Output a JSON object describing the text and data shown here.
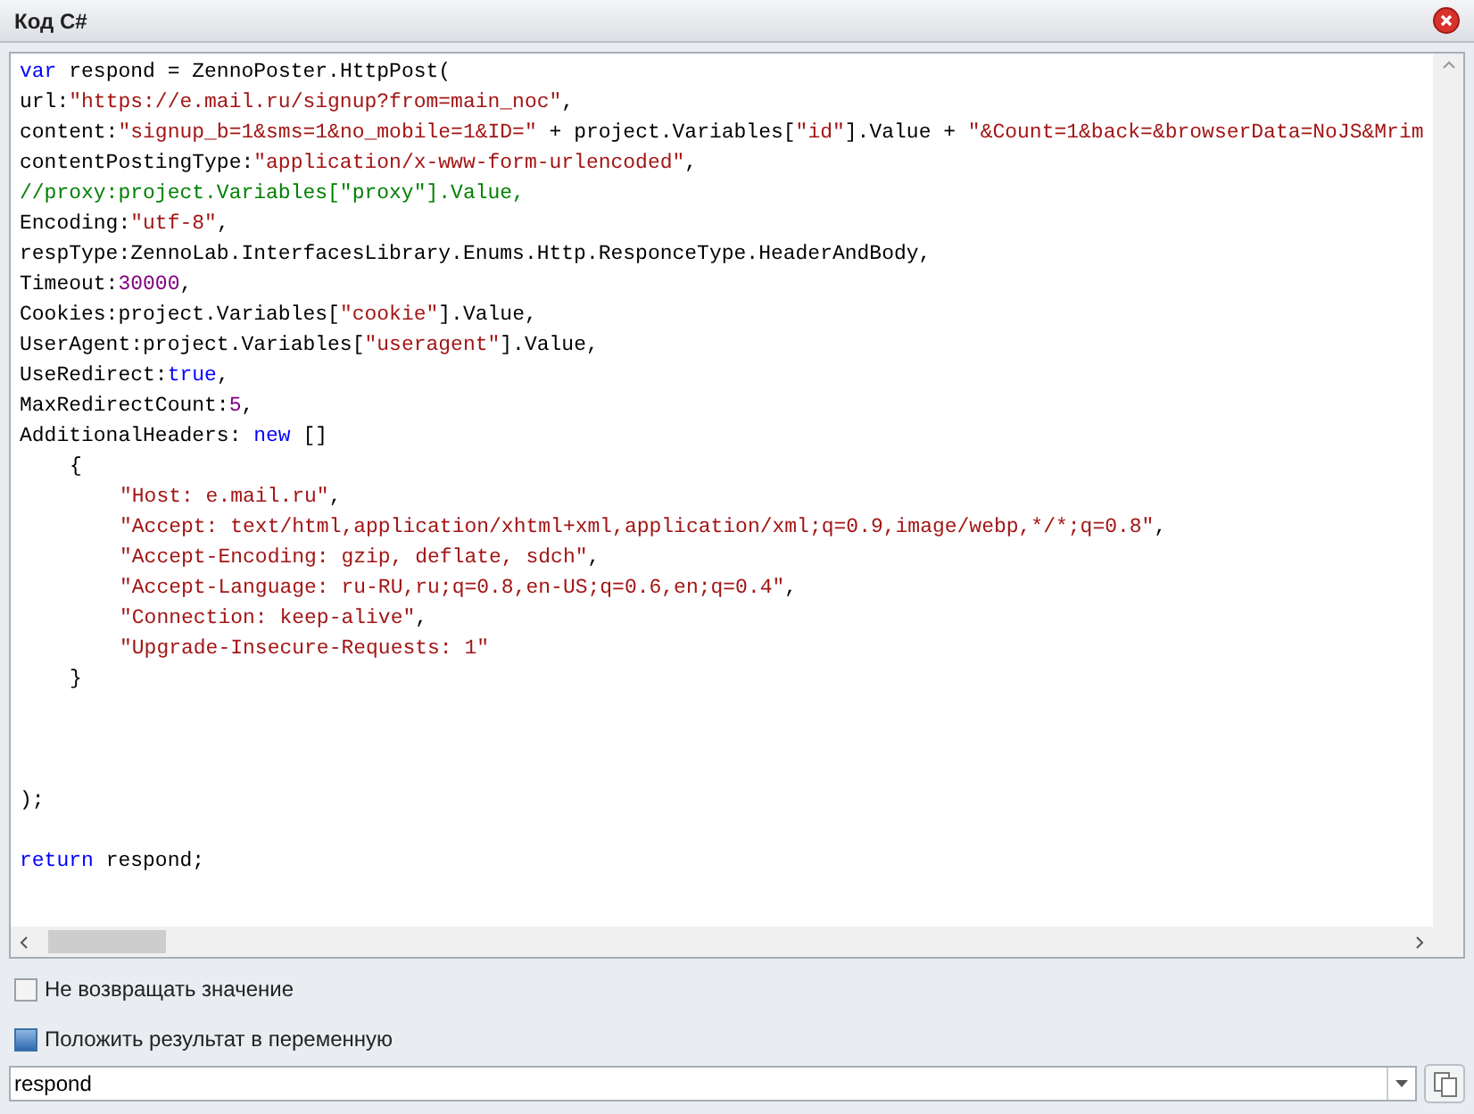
{
  "window": {
    "title": "Код C#"
  },
  "code": {
    "lines": [
      {
        "kind": "top",
        "tokens": [
          {
            "kind": "keyword",
            "text": "var"
          },
          {
            "kind": "plain",
            "text": " respond = ZennoPoster.HttpPost("
          }
        ]
      },
      {
        "kind": "top",
        "tokens": [
          {
            "kind": "plain",
            "text": "url:"
          },
          {
            "kind": "string",
            "text": "\"https://e.mail.ru/signup?from=main_noc\""
          },
          {
            "kind": "plain",
            "text": ","
          }
        ]
      },
      {
        "kind": "top",
        "tokens": [
          {
            "kind": "plain",
            "text": "content:"
          },
          {
            "kind": "string",
            "text": "\"signup_b=1&sms=1&no_mobile=1&ID=\""
          },
          {
            "kind": "plain",
            "text": " + project.Variables["
          },
          {
            "kind": "string",
            "text": "\"id\""
          },
          {
            "kind": "plain",
            "text": "].Value + "
          },
          {
            "kind": "string",
            "text": "\"&Count=1&back=&browserData=NoJS&Mrim"
          }
        ]
      },
      {
        "kind": "top",
        "tokens": [
          {
            "kind": "plain",
            "text": "contentPostingType:"
          },
          {
            "kind": "string",
            "text": "\"application/x-www-form-urlencoded\""
          },
          {
            "kind": "plain",
            "text": ","
          }
        ]
      },
      {
        "kind": "top",
        "tokens": [
          {
            "kind": "comment",
            "text": "//proxy:project.Variables[\"proxy\"].Value,"
          }
        ]
      },
      {
        "kind": "top",
        "tokens": [
          {
            "kind": "plain",
            "text": "Encoding:"
          },
          {
            "kind": "string",
            "text": "\"utf-8\""
          },
          {
            "kind": "plain",
            "text": ","
          }
        ]
      },
      {
        "kind": "top",
        "tokens": [
          {
            "kind": "plain",
            "text": "respType:ZennoLab.InterfacesLibrary.Enums.Http.ResponceType.HeaderAndBody,"
          }
        ]
      },
      {
        "kind": "top",
        "tokens": [
          {
            "kind": "plain",
            "text": "Timeout:"
          },
          {
            "kind": "number",
            "text": "30000"
          },
          {
            "kind": "plain",
            "text": ","
          }
        ]
      },
      {
        "kind": "top",
        "tokens": [
          {
            "kind": "plain",
            "text": "Cookies:project.Variables["
          },
          {
            "kind": "string",
            "text": "\"cookie\""
          },
          {
            "kind": "plain",
            "text": "].Value,"
          }
        ]
      },
      {
        "kind": "top",
        "tokens": [
          {
            "kind": "plain",
            "text": "UserAgent:project.Variables["
          },
          {
            "kind": "string",
            "text": "\"useragent\""
          },
          {
            "kind": "plain",
            "text": "].Value,"
          }
        ]
      },
      {
        "kind": "top",
        "tokens": [
          {
            "kind": "plain",
            "text": "UseRedirect:"
          },
          {
            "kind": "keyword",
            "text": "true"
          },
          {
            "kind": "plain",
            "text": ","
          }
        ]
      },
      {
        "kind": "top",
        "tokens": [
          {
            "kind": "plain",
            "text": "MaxRedirectCount:"
          },
          {
            "kind": "number",
            "text": "5"
          },
          {
            "kind": "plain",
            "text": ","
          }
        ]
      },
      {
        "kind": "top",
        "tokens": [
          {
            "kind": "plain",
            "text": "AdditionalHeaders: "
          },
          {
            "kind": "keyword",
            "text": "new"
          },
          {
            "kind": "plain",
            "text": " []"
          }
        ]
      },
      {
        "kind": "block",
        "tokens": [
          {
            "kind": "plain",
            "text": "{"
          }
        ]
      },
      {
        "kind": "inner",
        "tokens": [
          {
            "kind": "string",
            "text": "\"Host: e.mail.ru\""
          },
          {
            "kind": "plain",
            "text": ","
          }
        ]
      },
      {
        "kind": "inner",
        "tokens": [
          {
            "kind": "string",
            "text": "\"Accept: text/html,application/xhtml+xml,application/xml;q=0.9,image/webp,*/*;q=0.8\""
          },
          {
            "kind": "plain",
            "text": ","
          }
        ]
      },
      {
        "kind": "inner",
        "tokens": [
          {
            "kind": "string",
            "text": "\"Accept-Encoding: gzip, deflate, sdch\""
          },
          {
            "kind": "plain",
            "text": ","
          }
        ]
      },
      {
        "kind": "inner",
        "tokens": [
          {
            "kind": "string",
            "text": "\"Accept-Language: ru-RU,ru;q=0.8,en-US;q=0.6,en;q=0.4\""
          },
          {
            "kind": "plain",
            "text": ","
          }
        ]
      },
      {
        "kind": "inner",
        "tokens": [
          {
            "kind": "string",
            "text": "\"Connection: keep-alive\""
          },
          {
            "kind": "plain",
            "text": ","
          }
        ]
      },
      {
        "kind": "inner",
        "tokens": [
          {
            "kind": "string",
            "text": "\"Upgrade-Insecure-Requests: 1\""
          }
        ]
      },
      {
        "kind": "block",
        "tokens": [
          {
            "kind": "plain",
            "text": "}"
          }
        ]
      },
      {
        "kind": "blank"
      },
      {
        "kind": "blank"
      },
      {
        "kind": "blank"
      },
      {
        "kind": "top",
        "tokens": [
          {
            "kind": "plain",
            "text": ");"
          }
        ]
      },
      {
        "kind": "blank"
      },
      {
        "kind": "top",
        "tokens": [
          {
            "kind": "keyword",
            "text": "return"
          },
          {
            "kind": "plain",
            "text": " respond;"
          }
        ]
      }
    ]
  },
  "options": [
    {
      "label": "Не возвращать значение",
      "checked": false
    },
    {
      "label": "Положить результат в переменную",
      "checked": true
    }
  ],
  "variable_field": {
    "value": "respond"
  }
}
